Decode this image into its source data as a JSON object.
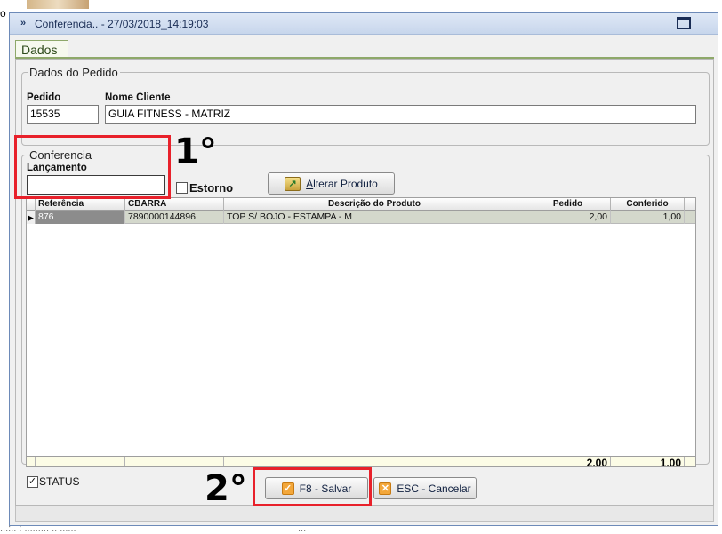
{
  "desktop": {
    "glyph": "o",
    "bottom_left_text": "...:..  : ......... .. ......",
    "bottom_right_text": "..."
  },
  "window": {
    "title": "Conferencia.. - 27/03/2018_14:19:03",
    "title_icon": "double-chevron-icon",
    "accent": "#c7d6ec"
  },
  "tab": {
    "label": "Dados"
  },
  "order": {
    "legend": "Dados do Pedido",
    "pedido_label": "Pedido",
    "pedido_value": "15535",
    "cliente_label": "Nome Cliente",
    "cliente_value": "GUIA FITNESS - MATRIZ"
  },
  "conferencia": {
    "legend": "Conferencia",
    "lancamento_label": "Lançamento",
    "lancamento_value": "",
    "estorno_label": "Estorno",
    "estorno_checked": false,
    "alterar_label": "Alterar Produto",
    "alterar_underline": "A",
    "alterar_rest": "lterar Produto"
  },
  "grid": {
    "columns": [
      "Referência",
      "CBARRA",
      "Descrição do Produto",
      "Pedido",
      "Conferido"
    ],
    "rows": [
      {
        "referencia": "876",
        "cbarra": "7890000144896",
        "descricao": "TOP S/ BOJO - ESTAMPA - M",
        "pedido": "2,00",
        "conferido": "1,00"
      }
    ],
    "totals": {
      "pedido": "2,00",
      "conferido": "1,00"
    },
    "row_indicator": "▶"
  },
  "status": {
    "label": "STATUS",
    "checked": true,
    "check_glyph": "✓"
  },
  "buttons": {
    "salvar": "F8 - Salvar",
    "cancelar": "ESC - Cancelar",
    "salvar_icon_glyph": "✓",
    "cancelar_icon_glyph": "✕"
  },
  "annotations": {
    "step1": "1°",
    "step2": "2°",
    "highlight_color": "#e8212b"
  }
}
